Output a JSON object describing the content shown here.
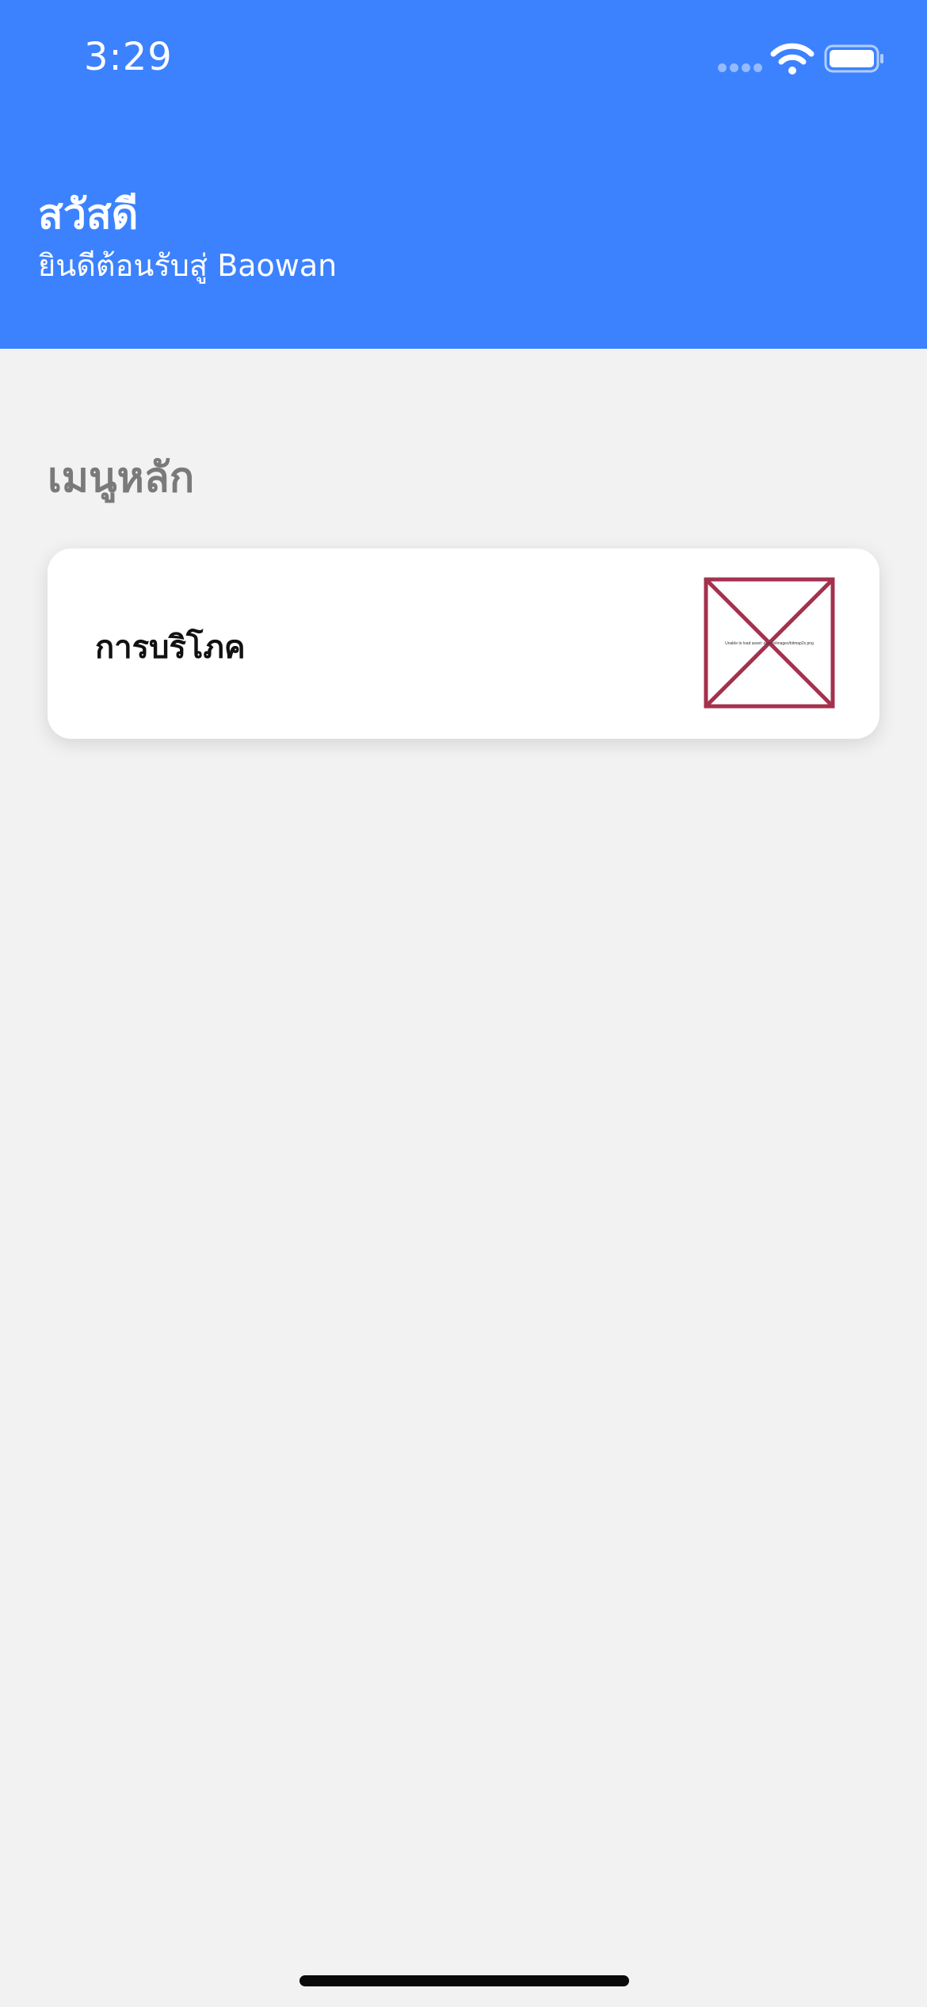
{
  "status_bar": {
    "time": "3:29"
  },
  "header": {
    "title": "สวัสดี",
    "subtitle": "ยินดีต้อนรับสู่ Baowan",
    "background_color": "#3c82ff"
  },
  "main": {
    "section_title": "เมนูหลัก",
    "menu_items": [
      {
        "label": "การบริโภค",
        "image_error_text": "Unable to load asset: assets/images/bitmap2x.png",
        "icon": "broken-image-icon",
        "error_color": "#a4314e"
      }
    ]
  },
  "colors": {
    "page_background": "#f2f2f2",
    "card_background": "#ffffff",
    "section_title": "#7a7a7a"
  }
}
